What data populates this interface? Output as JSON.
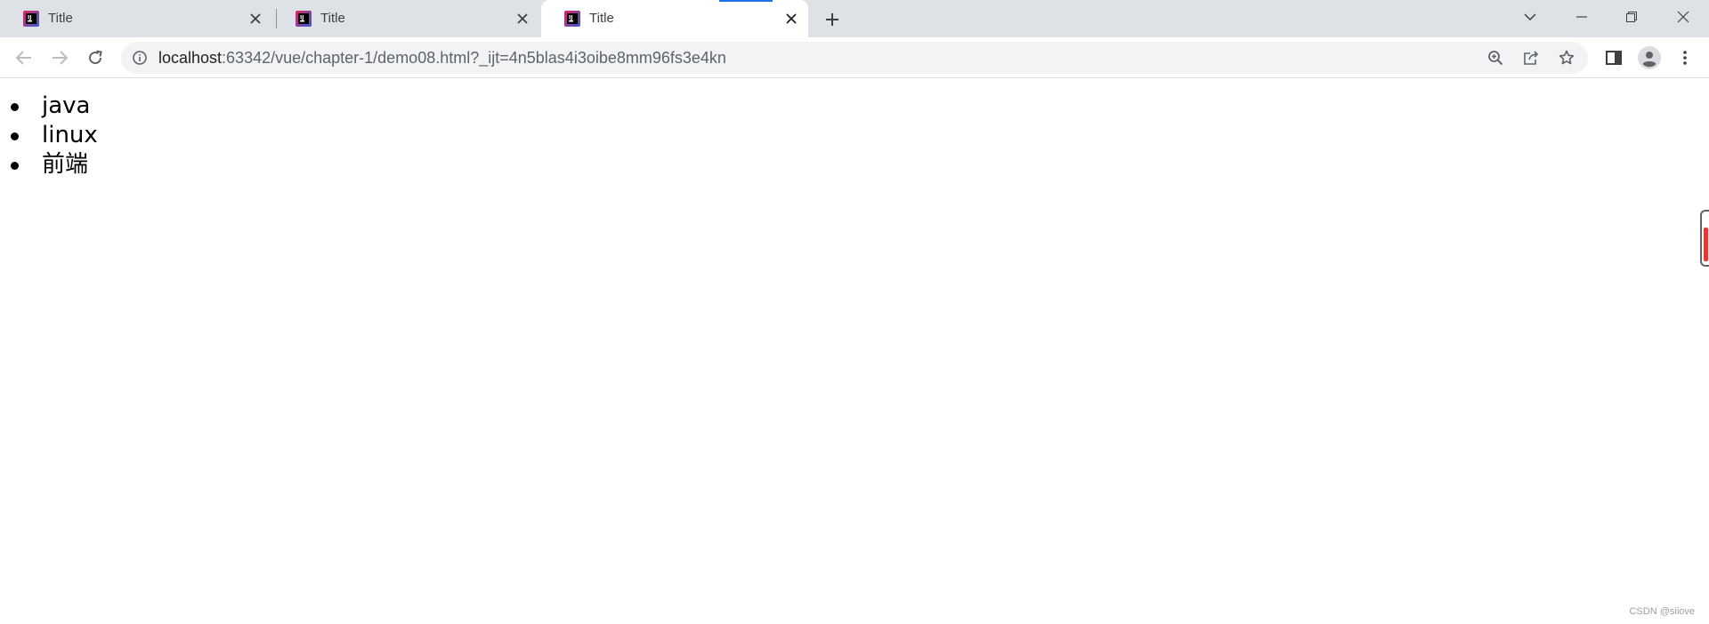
{
  "tabs": [
    {
      "title": "Title",
      "active": false
    },
    {
      "title": "Title",
      "active": false
    },
    {
      "title": "Title",
      "active": true
    }
  ],
  "address_bar": {
    "url_host": "localhost",
    "url_path": ":63342/vue/chapter-1/demo08.html?_ijt=4n5blas4i3oibe8mm96fs3e4kn"
  },
  "page": {
    "list_items": [
      "java",
      "linux",
      "前端"
    ]
  },
  "watermark": "CSDN @siiove",
  "colors": {
    "tabstrip": "#dee1e6",
    "omnibox": "#f1f3f4",
    "loading_bar": "#1a73e8",
    "favicon_red": "#e0245e",
    "favicon_blue": "#3b5bdb"
  },
  "icons": {
    "favicon": "jetbrains-favicon-icon",
    "tab_close": "close-icon",
    "new_tab": "plus-icon",
    "search_tabs": "chevron-down-icon",
    "minimize": "minimize-icon",
    "restore": "restore-icon",
    "close_window": "close-icon",
    "back": "arrow-left-icon",
    "forward": "arrow-right-icon",
    "reload": "reload-icon",
    "site_info": "info-icon",
    "zoom": "zoom-icon",
    "share": "share-icon",
    "bookmark": "star-icon",
    "side_panel": "side-panel-icon",
    "profile": "profile-icon",
    "menu": "kebab-menu-icon"
  }
}
